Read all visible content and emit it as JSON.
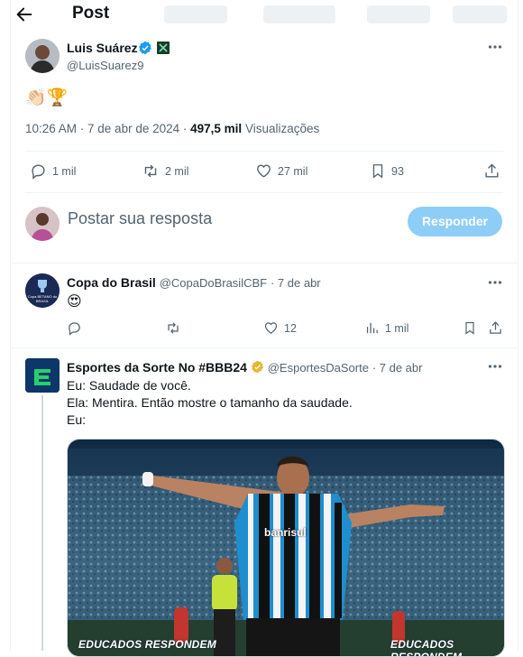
{
  "header": {
    "title": "Post"
  },
  "post": {
    "author": {
      "name": "Luis Suárez",
      "handle": "@LuisSuarez9"
    },
    "content_emoji": "👏🏻🏆",
    "timestamp": "10:26 AM · 7 de abr de 2024 ·",
    "views_count": "497,5 mil",
    "views_label": "Visualizações",
    "stats": {
      "replies": "1 mil",
      "reposts": "2 mil",
      "likes": "27 mil",
      "bookmarks": "93"
    }
  },
  "reply_box": {
    "placeholder": "Postar sua resposta",
    "button_label": "Responder"
  },
  "replies": [
    {
      "name": "Copa do Brasil",
      "handle": "@CopaDoBrasilCBF",
      "time": "· 7 de abr",
      "avatar_text": "Copa BETANO do BRASIL",
      "content_emoji": "😍",
      "stats": {
        "likes": "12",
        "views": "1 mil"
      }
    },
    {
      "name": "Esportes da Sorte No #BBB24",
      "handle": "@EsportesDaSorte",
      "time": "· 7 de abr",
      "lines": [
        "Eu: Saudade de você.",
        "Ela: Mentira. Então mostre o tamanho da saudade.",
        "Eu:"
      ],
      "media": {
        "jersey_text": "banrisul",
        "watermark_left": "EDUCADOS RESPONDEM",
        "watermark_right": "EDUCADOS RESPONDEM"
      }
    }
  ],
  "colors": {
    "accent": "#1d9bf0",
    "button_disabled": "#8ecdf7",
    "muted": "#536471",
    "gold_badge": "#e8b530"
  },
  "icons": [
    "back-arrow-icon",
    "verified-badge-icon",
    "team-badge-icon",
    "more-icon",
    "reply-icon",
    "repost-icon",
    "like-icon",
    "bookmark-icon",
    "share-icon",
    "views-icon"
  ]
}
